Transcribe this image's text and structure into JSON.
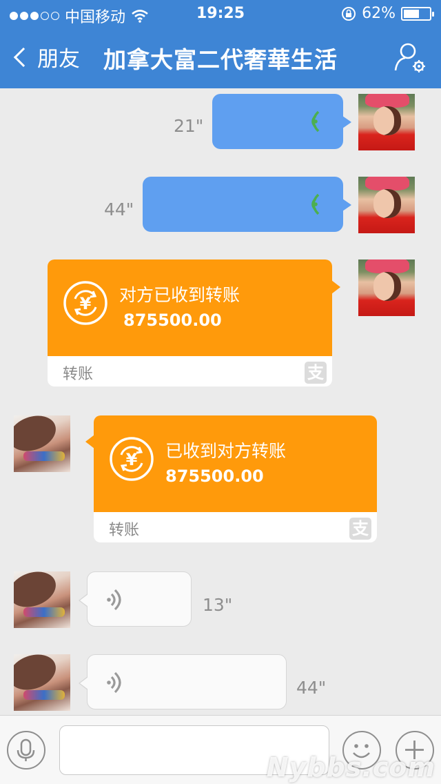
{
  "status_bar": {
    "carrier": "中国移动",
    "time": "19:25",
    "battery_text": "62%",
    "battery_level": 0.62,
    "signal_filled": 3,
    "signal_total": 5
  },
  "nav": {
    "back_label": "朋友",
    "title": "加拿大富二代奢華生活"
  },
  "messages": [
    {
      "type": "voice",
      "direction": "out",
      "duration": "21\""
    },
    {
      "type": "voice",
      "direction": "out",
      "duration": "44\""
    },
    {
      "type": "transfer",
      "direction": "out",
      "text": "对方已收到转账",
      "amount": "875500.00",
      "label": "转账"
    },
    {
      "type": "transfer",
      "direction": "in",
      "text": "已收到对方转账",
      "amount": "875500.00",
      "label": "转账"
    },
    {
      "type": "voice",
      "direction": "in",
      "duration": "13\""
    },
    {
      "type": "voice",
      "direction": "in",
      "duration": "44\""
    }
  ],
  "transfer_brand_glyph": "支",
  "input_bar": {
    "placeholder": "",
    "icons": [
      "microphone-icon",
      "emoji-icon",
      "plus-icon"
    ]
  },
  "watermark": "Nybbs.com",
  "colors": {
    "nav_blue": "#3e85d5",
    "outgoing_bubble": "#5f9ff0",
    "transfer_orange": "#ff9a0b",
    "voice_wave_green": "#4caf50"
  }
}
